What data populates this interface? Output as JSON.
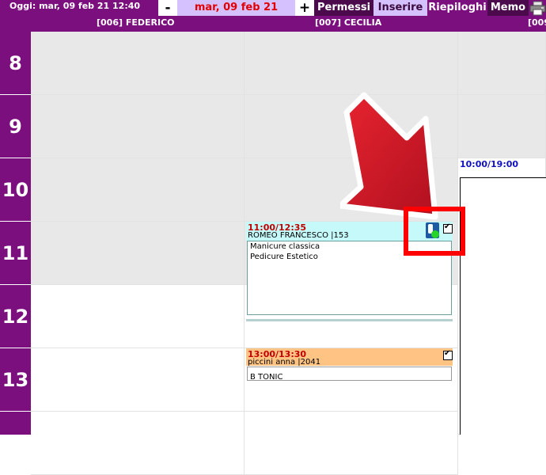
{
  "header": {
    "today_label": "Oggi: mar, 09 feb 21 12:40",
    "minus_label": "-",
    "current_date": "mar, 09 feb 21",
    "plus_label": "+",
    "menu": {
      "permessi": "Permessi",
      "inserire": "Inserire",
      "riepiloghi": "Riepiloghi",
      "memo": "Memo"
    },
    "printer_icon": "printer-icon"
  },
  "staff": {
    "federico": "[006] FEDERICO",
    "cecilia": "[007] CECILIA",
    "third": "[009"
  },
  "hours": [
    "8",
    "9",
    "10",
    "11",
    "12",
    "13"
  ],
  "appointments": [
    {
      "time": "11:00/12:35",
      "client": "ROMEO FRANCESCO |153",
      "services": [
        "Manicure classica",
        "Pedicure Estetico"
      ],
      "header_color": "#c6fafa",
      "status_icon": "app-status-icon"
    },
    {
      "time": "13:00/13:30",
      "client": "piccini anna |2041",
      "services": [
        "B TONIC"
      ],
      "header_color": "#ffc484"
    }
  ],
  "shift": {
    "time": "10:00/19:00"
  },
  "colors": {
    "brand": "#7b0f7e",
    "accent_light": "#d6c1ff",
    "date_text": "#e00000",
    "closed_cell": "#e8e8e8",
    "highlight": "#ff0000"
  }
}
